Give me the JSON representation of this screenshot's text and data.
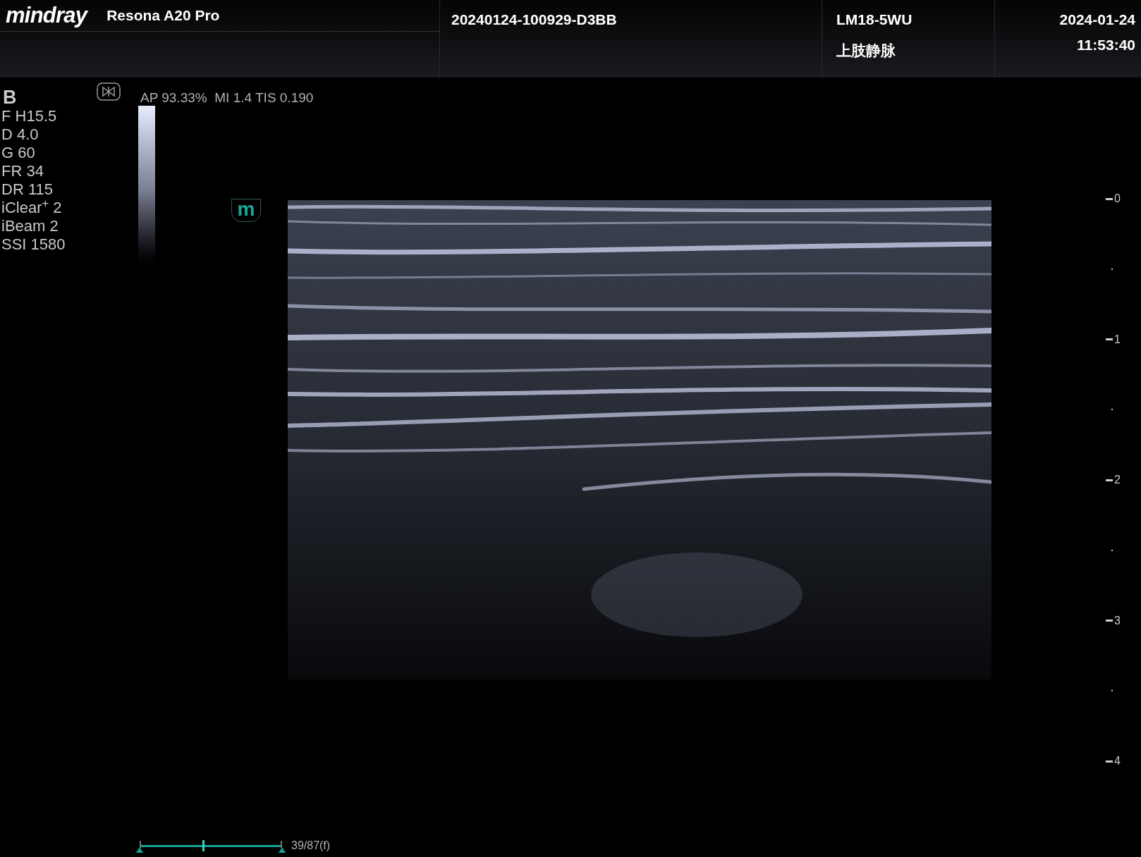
{
  "header": {
    "logo": "mindray",
    "system": "Resona A20 Pro",
    "exam_id": "20240124-100929-D3BB",
    "probe": "LM18-5WU",
    "preset": "上肢静脉",
    "date": "2024-01-24",
    "time": "11:53:40"
  },
  "mode": "B",
  "parameters": [
    "F H15.5",
    "D 4.0",
    "G 60",
    "FR 34",
    "DR 115",
    "iClear$^{+}$ 2",
    "iBeam 2",
    "SSI 1580"
  ],
  "acoustic_output": "AP 93.33%  MI 1.4 TIS 0.190",
  "orientation_mark": "m",
  "depth_scale": [
    "0",
    "1",
    "2",
    "3",
    "4"
  ],
  "cine": {
    "level": 0.448,
    "frame": "39/87(f)"
  }
}
